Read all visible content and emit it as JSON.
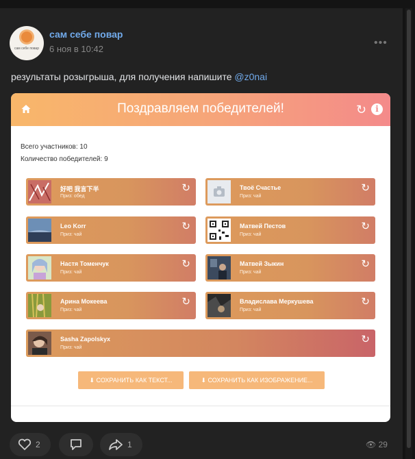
{
  "post": {
    "author": "сам себе повар",
    "avatar_brand": "сам себе повар",
    "date": "6 ноя в 10:42",
    "more_icon": "more-dots-icon",
    "text_before": "результаты розыгрыша, для получения напишите ",
    "mention": "@z0nai"
  },
  "widget": {
    "title": "Поздравляем победителей!",
    "total_participants": "Всего участников: 10",
    "winners_count": "Количество победителей: 9",
    "info_glyph": "i",
    "winners": [
      {
        "name": "好吧 我言下半",
        "prize": "Приз: обед"
      },
      {
        "name": "Твоё Счастье",
        "prize": "Приз: чай"
      },
      {
        "name": "Leo Korr",
        "prize": "Приз: чай"
      },
      {
        "name": "Матвей Пестов",
        "prize": "Приз: чай"
      },
      {
        "name": "Настя Томенчук",
        "prize": "Приз: чай"
      },
      {
        "name": "Матвей Зыкин",
        "prize": "Приз: чай"
      },
      {
        "name": "Арина Мокеева",
        "prize": "Приз: чай"
      },
      {
        "name": "Владислава Меркушева",
        "prize": "Приз: чай"
      },
      {
        "name": "Sasha Zapolskyx",
        "prize": "Приз: чай"
      }
    ],
    "save_text_label": "СОХРАНИТЬ КАК ТЕКСТ...",
    "save_image_label": "СОХРАНИТЬ КАК ИЗОБРАЖЕНИЕ...",
    "colors": {
      "header_start": "#f8b76a",
      "header_end": "#f48a8a",
      "tile": "#dd9a5c",
      "button": "#f6b87a"
    }
  },
  "actions": {
    "likes": "2",
    "shares": "1",
    "views": "29"
  }
}
